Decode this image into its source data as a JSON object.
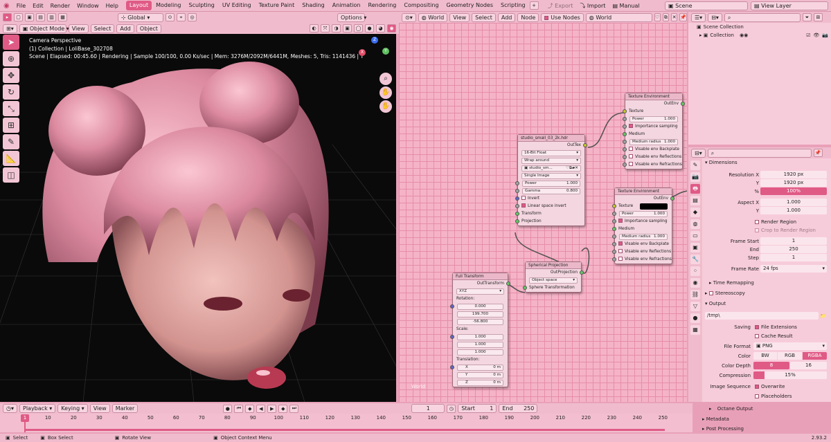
{
  "topbar": {
    "menus": [
      "File",
      "Edit",
      "Render",
      "Window",
      "Help"
    ],
    "workspaces": [
      "Layout",
      "Modeling",
      "Sculpting",
      "UV Editing",
      "Texture Paint",
      "Shading",
      "Animation",
      "Rendering",
      "Compositing",
      "Geometry Nodes",
      "Scripting"
    ],
    "active_workspace": "Layout",
    "export": "Export",
    "import": "Import",
    "manual": "Manual",
    "scene": "Scene",
    "view_layer": "View Layer"
  },
  "viewport": {
    "orientation": "Global",
    "options": "Options",
    "mode": "Object Mode",
    "menu": [
      "View",
      "Select",
      "Add",
      "Object"
    ],
    "overlay_lines": [
      "Camera Perspective",
      "(1) Collection | LoliBase_302708",
      "Scene | Elapsed: 00:45.60 | Rendering | Sample 100/100, 0.00 Ks/sec | Mem: 3276M/2092M/6441M, Meshes: 5, Tris: 1141436 | Tex: ( Rgb32: 19, Rgb"
    ],
    "gizmo": {
      "x": "X",
      "y": "Y",
      "z": "Z"
    }
  },
  "node_editor": {
    "world_dropdown": "World",
    "menu": [
      "View",
      "Select",
      "Add",
      "Node"
    ],
    "use_nodes": "Use Nodes",
    "world_name": "World",
    "corner_label": "World",
    "tex_env_1": {
      "title": "Texture Environment",
      "out": "OutEnv",
      "texture": "Texture",
      "power_label": "Power",
      "power": "1.000",
      "importance": "Importance sampling",
      "medium": "Medium",
      "medium_radius_label": "Medium radius",
      "medium_radius": "1.000",
      "backplate": "Visable env Backplate",
      "reflections": "Visable env Reflections",
      "refractions": "Visable env Refractions"
    },
    "tex_env_2": {
      "title": "Texture Environment",
      "out": "OutEnv",
      "texture": "Texture",
      "power_label": "Power",
      "power": "1.000",
      "importance": "Importance sampling",
      "medium": "Medium",
      "medium_radius_label": "Medium radius",
      "medium_radius": "1.000",
      "backplate": "Visable env Backplate",
      "reflections": "Visable env Reflections",
      "refractions": "Visable env Refractions"
    },
    "image_node": {
      "title": "studio_small_03_2k.hdr",
      "out": "OutTex",
      "format": "16-Bit Float",
      "wrap": "Wrap around",
      "image": "studio_sm...",
      "source": "Single Image",
      "power_label": "Power",
      "power": "1.000",
      "gamma_label": "Gamma",
      "gamma": "0.800",
      "invert": "Invert",
      "linear": "Linear space invert",
      "transform": "Transform",
      "projection": "Projection"
    },
    "spherical": {
      "title": "Spherical Projection",
      "out": "OutProjection",
      "space": "Object space",
      "sphere": "Sphere Transformation"
    },
    "full_transform": {
      "title": "Full Transform",
      "out": "OutTransform",
      "order": "XYZ",
      "rotation": "Rotation:",
      "rot": [
        "0.000",
        "199.700",
        "-56.800"
      ],
      "scale": "Scale:",
      "scl": [
        "1.000",
        "1.000",
        "1.000"
      ],
      "translation": "Translation:",
      "tr_labels": [
        "X",
        "Y",
        "Z"
      ],
      "tr": [
        "0 m",
        "0 m",
        "0 m"
      ]
    }
  },
  "outliner": {
    "scene_collection": "Scene Collection",
    "collection": "Collection"
  },
  "properties": {
    "dimensions": "Dimensions",
    "res_x_label": "Resolution X",
    "res_x": "1920 px",
    "res_y_label": "Y",
    "res_y": "1920 px",
    "pct_label": "%",
    "pct": "100%",
    "aspect_x_label": "Aspect X",
    "aspect_x": "1.000",
    "aspect_y_label": "Y",
    "aspect_y": "1.000",
    "render_region": "Render Region",
    "crop": "Crop to Render Region",
    "frame_start_label": "Frame Start",
    "frame_start": "1",
    "end_label": "End",
    "end": "250",
    "step_label": "Step",
    "step": "1",
    "frame_rate_label": "Frame Rate",
    "frame_rate": "24 fps",
    "time_remapping": "Time Remapping",
    "stereoscopy": "Stereoscopy",
    "output": "Output",
    "path": "/tmp\\",
    "saving_label": "Saving",
    "file_ext": "File Extensions",
    "cache": "Cache Result",
    "file_format_label": "File Format",
    "file_format": "PNG",
    "color_label": "Color",
    "color_opts": [
      "BW",
      "RGB",
      "RGBA"
    ],
    "color_active": "RGBA",
    "depth_label": "Color Depth",
    "depth_opts": [
      "8",
      "16"
    ],
    "compression_label": "Compression",
    "compression": "15%",
    "sequence_label": "Image Sequence",
    "overwrite": "Overwrite",
    "placeholders": "Placeholders",
    "octane_output": "Octane Output",
    "metadata": "Metadata",
    "post": "Post Processing"
  },
  "timeline": {
    "menu": [
      "Playback",
      "Keying",
      "View",
      "Marker"
    ],
    "current": "1",
    "start_label": "Start",
    "start": "1",
    "end_label": "End",
    "end": "250",
    "ticks": [
      "1",
      "10",
      "20",
      "30",
      "40",
      "50",
      "60",
      "70",
      "80",
      "90",
      "100",
      "110",
      "120",
      "130",
      "140",
      "150",
      "160",
      "170",
      "180",
      "190",
      "200",
      "210",
      "220",
      "230",
      "240",
      "250"
    ]
  },
  "status": {
    "select": "Select",
    "box": "Box Select",
    "rotate": "Rotate View",
    "context": "Object Context Menu",
    "version": "2.93.2"
  },
  "colors": {
    "accent": "#e05a86",
    "panel": "#f0bccd",
    "grid": "#f5b3c7"
  }
}
